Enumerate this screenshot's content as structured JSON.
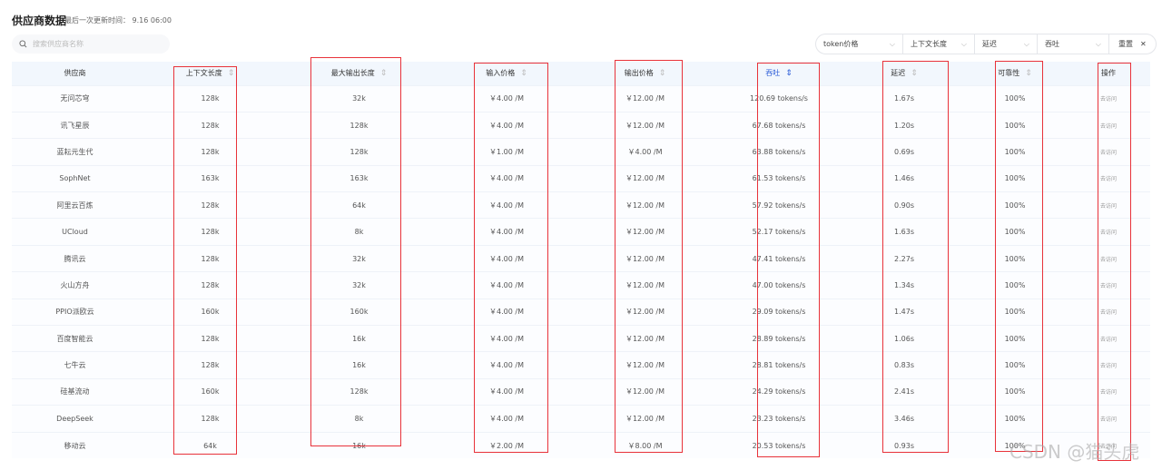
{
  "header": {
    "title": "供应商数据",
    "updated_label": "最后一次更新时间：",
    "updated_value": "9.16 06:00"
  },
  "search": {
    "placeholder": "搜索供应商名称"
  },
  "filters": [
    {
      "label": "token价格"
    },
    {
      "label": "上下文长度"
    },
    {
      "label": "延迟"
    },
    {
      "label": "吞吐"
    }
  ],
  "reset_label": "重置",
  "columns": [
    "供应商",
    "上下文长度",
    "最大输出长度",
    "输入价格",
    "输出价格",
    "吞吐",
    "延迟",
    "可靠性",
    "操作"
  ],
  "rows": [
    [
      "无问芯穹",
      "128k",
      "32k",
      "￥4.00 /M",
      "￥12.00 /M",
      "120.69 tokens/s",
      "1.67s",
      "100%",
      "去访问"
    ],
    [
      "讯飞星辰",
      "128k",
      "128k",
      "￥4.00 /M",
      "￥12.00 /M",
      "67.68 tokens/s",
      "1.20s",
      "100%",
      "去访问"
    ],
    [
      "蓝耘元生代",
      "128k",
      "128k",
      "￥1.00 /M",
      "￥4.00 /M",
      "63.88 tokens/s",
      "0.69s",
      "100%",
      "去访问"
    ],
    [
      "SophNet",
      "163k",
      "163k",
      "￥4.00 /M",
      "￥12.00 /M",
      "61.53 tokens/s",
      "1.46s",
      "100%",
      "去访问"
    ],
    [
      "阿里云百炼",
      "128k",
      "64k",
      "￥4.00 /M",
      "￥12.00 /M",
      "57.92 tokens/s",
      "0.90s",
      "100%",
      "去访问"
    ],
    [
      "UCloud",
      "128k",
      "8k",
      "￥4.00 /M",
      "￥12.00 /M",
      "52.17 tokens/s",
      "1.63s",
      "100%",
      "去访问"
    ],
    [
      "腾讯云",
      "128k",
      "32k",
      "￥4.00 /M",
      "￥12.00 /M",
      "47.41 tokens/s",
      "2.27s",
      "100%",
      "去访问"
    ],
    [
      "火山方舟",
      "128k",
      "32k",
      "￥4.00 /M",
      "￥12.00 /M",
      "47.00 tokens/s",
      "1.34s",
      "100%",
      "去访问"
    ],
    [
      "PPIO派欧云",
      "160k",
      "160k",
      "￥4.00 /M",
      "￥12.00 /M",
      "29.09 tokens/s",
      "1.47s",
      "100%",
      "去访问"
    ],
    [
      "百度智能云",
      "128k",
      "16k",
      "￥4.00 /M",
      "￥12.00 /M",
      "28.89 tokens/s",
      "1.06s",
      "100%",
      "去访问"
    ],
    [
      "七牛云",
      "128k",
      "16k",
      "￥4.00 /M",
      "￥12.00 /M",
      "28.81 tokens/s",
      "0.83s",
      "100%",
      "去访问"
    ],
    [
      "硅基流动",
      "160k",
      "128k",
      "￥4.00 /M",
      "￥12.00 /M",
      "24.29 tokens/s",
      "2.41s",
      "100%",
      "去访问"
    ],
    [
      "DeepSeek",
      "128k",
      "8k",
      "￥4.00 /M",
      "￥12.00 /M",
      "23.23 tokens/s",
      "3.46s",
      "100%",
      "去访问"
    ],
    [
      "移动云",
      "64k",
      "16k",
      "￥2.00 /M",
      "￥8.00 /M",
      "20.53 tokens/s",
      "0.93s",
      "100%",
      "去访问"
    ]
  ],
  "watermark": "CSDN @猫头虎",
  "colors": {
    "accent": "#2a5bd7",
    "annotation": "#e8323a"
  }
}
